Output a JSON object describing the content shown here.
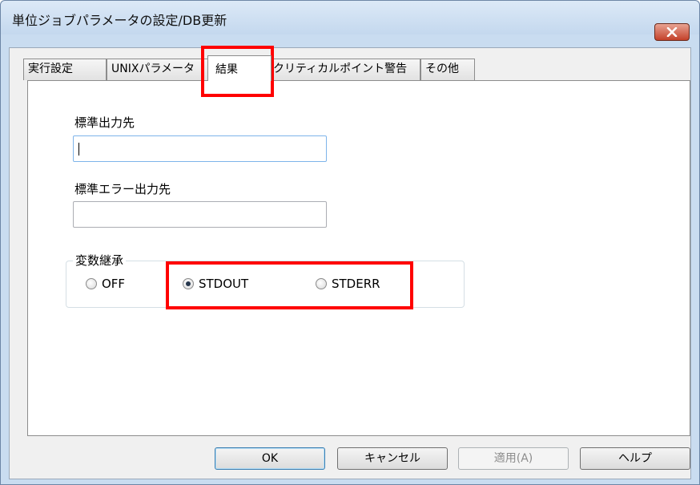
{
  "window": {
    "title": "単位ジョブパラメータの設定/DB更新"
  },
  "tabs": [
    {
      "label": "実行設定"
    },
    {
      "label": "UNIXパラメータ"
    },
    {
      "label": "結果"
    },
    {
      "label": "クリティカルポイント警告"
    },
    {
      "label": "その他"
    }
  ],
  "active_tab": "結果",
  "form": {
    "stdout": {
      "label": "標準出力先",
      "value": ""
    },
    "stderr": {
      "label": "標準エラー出力先",
      "value": ""
    },
    "inherit": {
      "legend": "変数継承",
      "options": [
        {
          "label": "OFF",
          "checked": false
        },
        {
          "label": "STDOUT",
          "checked": true
        },
        {
          "label": "STDERR",
          "checked": false
        }
      ]
    }
  },
  "buttons": {
    "ok": "OK",
    "cancel": "キャンセル",
    "apply": "適用(A)",
    "help": "ヘルプ"
  },
  "colors": {
    "highlight": "#ff0000",
    "title_bar": "#c9dcf0",
    "close_button": "#c4412a"
  }
}
